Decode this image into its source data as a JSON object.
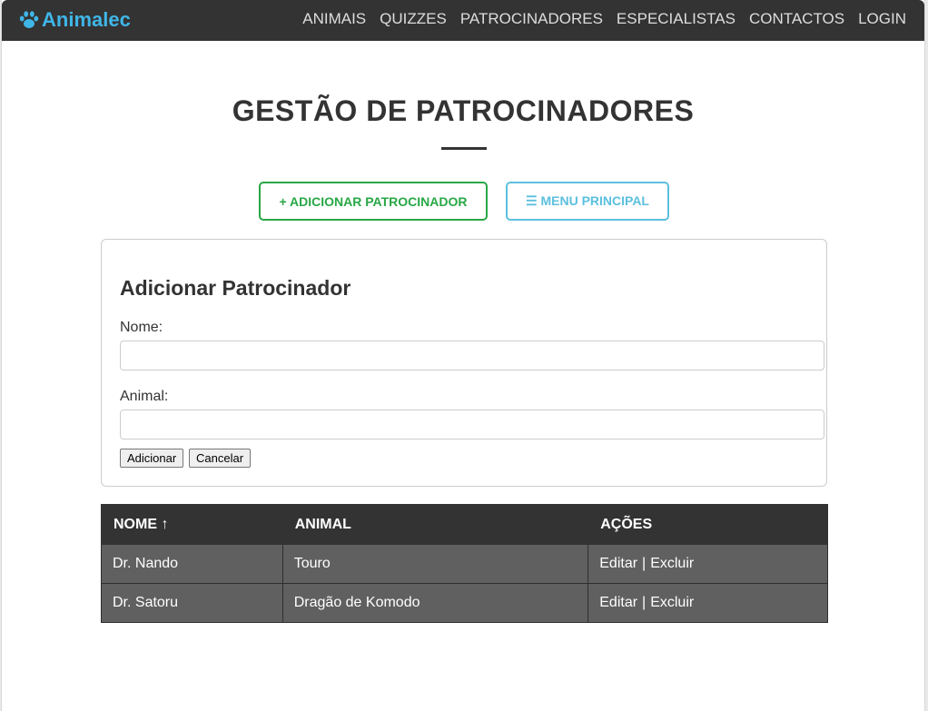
{
  "brand": {
    "name": "Animalec",
    "icon": "paw-icon",
    "color": "#3fb6e8"
  },
  "nav": {
    "items": [
      {
        "label": "ANIMAIS"
      },
      {
        "label": "QUIZZES"
      },
      {
        "label": "PATROCINADORES"
      },
      {
        "label": "ESPECIALISTAS"
      },
      {
        "label": "CONTACTOS"
      },
      {
        "label": "LOGIN"
      }
    ]
  },
  "page": {
    "title": "GESTÃO DE PATROCINADORES"
  },
  "actions": {
    "add_label": "+ ADICIONAR PATROCINADOR",
    "menu_label": "☰ MENU PRINCIPAL",
    "add_color": "#28a745",
    "menu_color": "#5bc0de"
  },
  "form": {
    "heading": "Adicionar Patrocinador",
    "name_label": "Nome:",
    "name_value": "",
    "animal_label": "Animal:",
    "animal_value": "",
    "submit_label": "Adicionar",
    "cancel_label": "Cancelar"
  },
  "table": {
    "headers": [
      "NOME ↑",
      "ANIMAL",
      "AÇÕES"
    ],
    "rows": [
      {
        "nome": "Dr. Nando",
        "animal": "Touro",
        "edit": "Editar",
        "sep": "|",
        "delete": "Excluir"
      },
      {
        "nome": "Dr. Satoru",
        "animal": "Dragão de Komodo",
        "edit": "Editar",
        "sep": "|",
        "delete": "Excluir"
      }
    ]
  }
}
